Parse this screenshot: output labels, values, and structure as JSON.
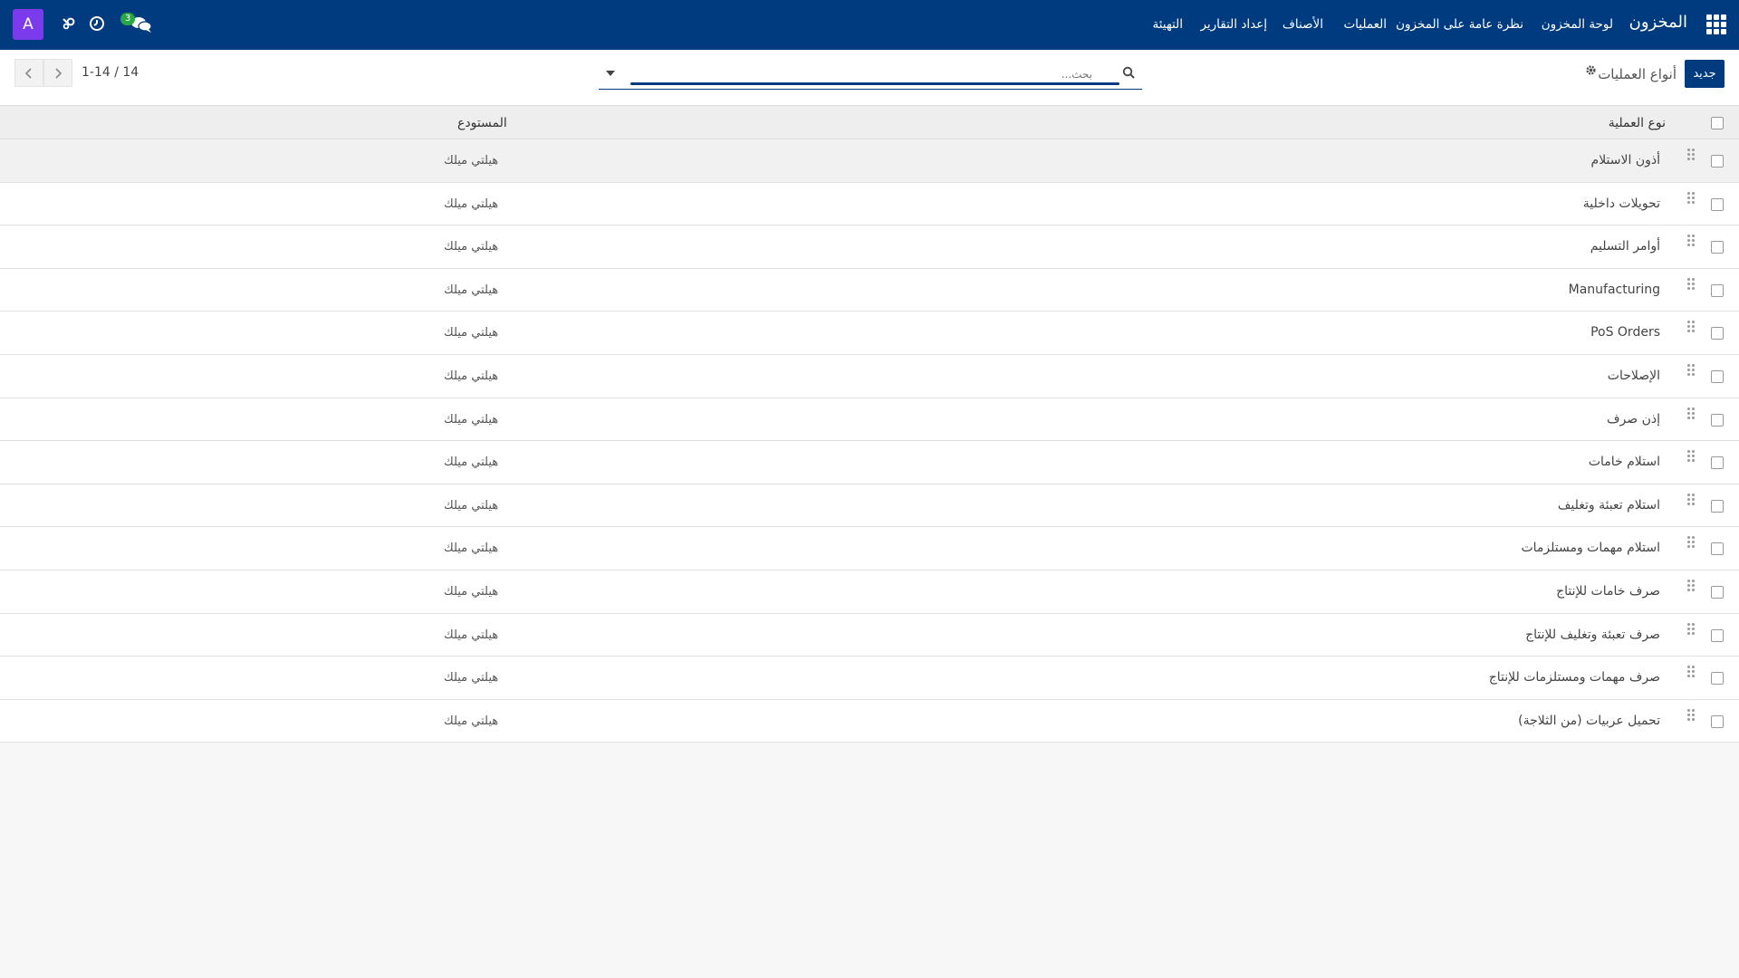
{
  "navbar": {
    "brand": "المخزون",
    "menu": [
      "لوحة المخزون",
      "نظرة عامة على المخزون",
      "العمليات",
      "الأصناف",
      "إعداد التقارير",
      "التهيئة"
    ],
    "avatar_letter": "A",
    "messages_badge": "3",
    "icons": [
      "apps-grid-icon",
      "chat-icon",
      "clock-icon",
      "tools-icon"
    ]
  },
  "control": {
    "new_button": "جديد",
    "breadcrumb": "أنواع العمليات",
    "search_placeholder": "بحث...",
    "pager": "1-14 / 14"
  },
  "table": {
    "headers": {
      "operation_type": "نوع العملية",
      "warehouse": "المستودع"
    },
    "rows": [
      {
        "operation_type": "أذون الاستلام",
        "warehouse": "هيلتي ميلك"
      },
      {
        "operation_type": "تحويلات داخلية",
        "warehouse": "هيلتي ميلك"
      },
      {
        "operation_type": "أوامر التسليم",
        "warehouse": "هيلتي ميلك"
      },
      {
        "operation_type": "Manufacturing",
        "warehouse": "هيلتي ميلك"
      },
      {
        "operation_type": "PoS Orders",
        "warehouse": "هيلتي ميلك"
      },
      {
        "operation_type": "الإصلاحات",
        "warehouse": "هيلتي ميلك"
      },
      {
        "operation_type": "إذن صرف",
        "warehouse": "هيلتي ميلك"
      },
      {
        "operation_type": "استلام خامات",
        "warehouse": "هيلتي ميلك"
      },
      {
        "operation_type": "استلام تعبئة وتغليف",
        "warehouse": "هيلتي ميلك"
      },
      {
        "operation_type": "استلام مهمات ومستلزمات",
        "warehouse": "هيلتي ميلك"
      },
      {
        "operation_type": "صرف خامات للإنتاج",
        "warehouse": "هيلتي ميلك"
      },
      {
        "operation_type": "صرف تعبئة وتغليف للإنتاج",
        "warehouse": "هيلتي ميلك"
      },
      {
        "operation_type": "صرف مهمات ومستلزمات للإنتاج",
        "warehouse": "هيلتي ميلك"
      },
      {
        "operation_type": "تحميل عربيات (من الثلاجة)",
        "warehouse": "هيلتي ميلك"
      }
    ]
  },
  "colors": {
    "navbar": "#003a7f",
    "avatar": "#7c3aed",
    "badge": "#28a745"
  }
}
